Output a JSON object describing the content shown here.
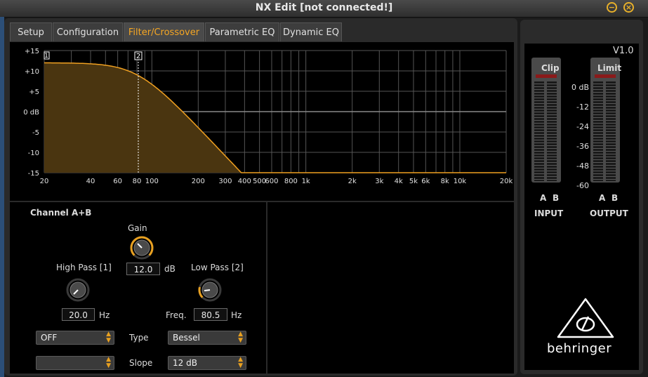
{
  "window": {
    "title": "NX Edit [not connected!]"
  },
  "tabs": [
    {
      "label": "Setup",
      "active": false
    },
    {
      "label": "Configuration",
      "active": false
    },
    {
      "label": "Filter/Crossover",
      "active": true
    },
    {
      "label": "Parametric EQ",
      "active": false
    },
    {
      "label": "Dynamic EQ",
      "active": false
    }
  ],
  "graph": {
    "y_labels": [
      "+15",
      "+10",
      "+5",
      "0 dB",
      "-5",
      "-10",
      "-15"
    ],
    "x_labels": [
      "20",
      "40",
      "60",
      "80",
      "100",
      "200",
      "300",
      "400",
      "500",
      "600",
      "800",
      "1k",
      "2k",
      "3k",
      "4k",
      "5k",
      "6k",
      "8k",
      "10k",
      "20k"
    ],
    "marker_1": "1",
    "marker_2": "2",
    "fill_color": "#4a3510",
    "curve_color": "#f0a020"
  },
  "channel": {
    "title": "Channel A+B",
    "gain": {
      "label": "Gain",
      "value": "12.0",
      "unit": "dB"
    },
    "high_pass": {
      "label": "High Pass [1]",
      "value": "20.0",
      "unit": "Hz",
      "type": "OFF",
      "slope": ""
    },
    "low_pass": {
      "label": "Low Pass [2]",
      "freq_label": "Freq.",
      "value": "80.5",
      "unit": "Hz",
      "type": "Bessel",
      "slope": "12 dB"
    },
    "type_label": "Type",
    "slope_label": "Slope"
  },
  "meters": {
    "version": "V1.0",
    "clip_label": "Clip",
    "limit_label": "Limit",
    "scale": [
      "0 dB",
      "-12",
      "-24",
      "-36",
      "-48",
      "-60"
    ],
    "ab_a": "A",
    "ab_b": "B",
    "input_label": "INPUT",
    "output_label": "OUTPUT"
  },
  "brand": {
    "name": "behringer"
  }
}
